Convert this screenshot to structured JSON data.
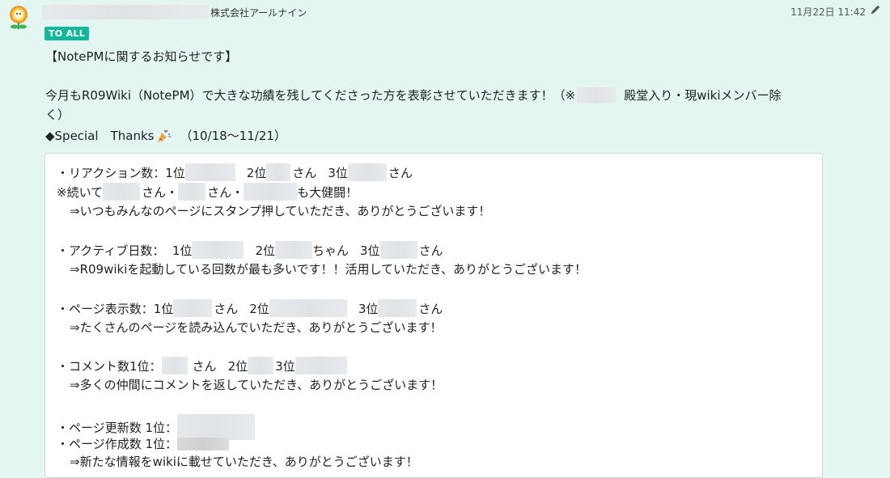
{
  "message": {
    "company": "株式会社アールナイン",
    "timestamp": "11月22日 11:42",
    "badge": "TO ALL",
    "icons": {
      "avatar": "flower-avatar-icon",
      "edit": "pencil-icon",
      "party": "party-popper-icon"
    },
    "colors": {
      "background": "#e3f6f1",
      "badge": "#13b89c",
      "card": "#ffffff"
    }
  },
  "body": {
    "heading": "【NotePMに関するお知らせです】",
    "intro_line1": "今月もR09Wiki（NotePM）で大きな功績を残してくださった方を表彰させていただきます！（※",
    "intro_line1_tail": "殿堂入り・現wikiメンバー除",
    "intro_line2": "く）",
    "special": "◆Special　Thanks",
    "special_period": "（10/18～11/21）"
  },
  "card": {
    "reaction": {
      "prefix": "・リアクション数：1位",
      "rank2": "2位",
      "san": "さん",
      "rank3": "3位",
      "san3": "さん"
    },
    "reaction_note": {
      "prefix": "※続いて",
      "s1": "さん・",
      "s2": "さん・",
      "tail": "も大健闘！"
    },
    "reaction_thanks": "⇒いつもみんなのページにスタンプ押していただき、ありがとうございます！",
    "active": {
      "prefix": "・アクティブ日数：  1位",
      "rank2": "2位",
      "chan": "ちゃん",
      "rank3": "3位",
      "san": "さん"
    },
    "active_thanks": "⇒R09wikiを起動している回数が最も多いです！！活用していただき、ありがとうございます！",
    "views": {
      "prefix": "・ページ表示数：1位",
      "san": "さん",
      "rank2": "2位",
      "rank3": "3位",
      "san3": "さん"
    },
    "views_thanks": "⇒たくさんのページを読み込んでいただき、ありがとうございます！",
    "comments": {
      "prefix": "・コメント数1位：",
      "san": "さん",
      "rank2": "2位",
      "rank3": "3位"
    },
    "comments_thanks": "⇒多くの仲間にコメントを返していただき、ありがとうございます！",
    "updates": "・ページ更新数 1位：",
    "created": "・ページ作成数 1位：",
    "cut_line": "⇒新たな情報をwikiに載せていただき、ありがとうございます！"
  }
}
